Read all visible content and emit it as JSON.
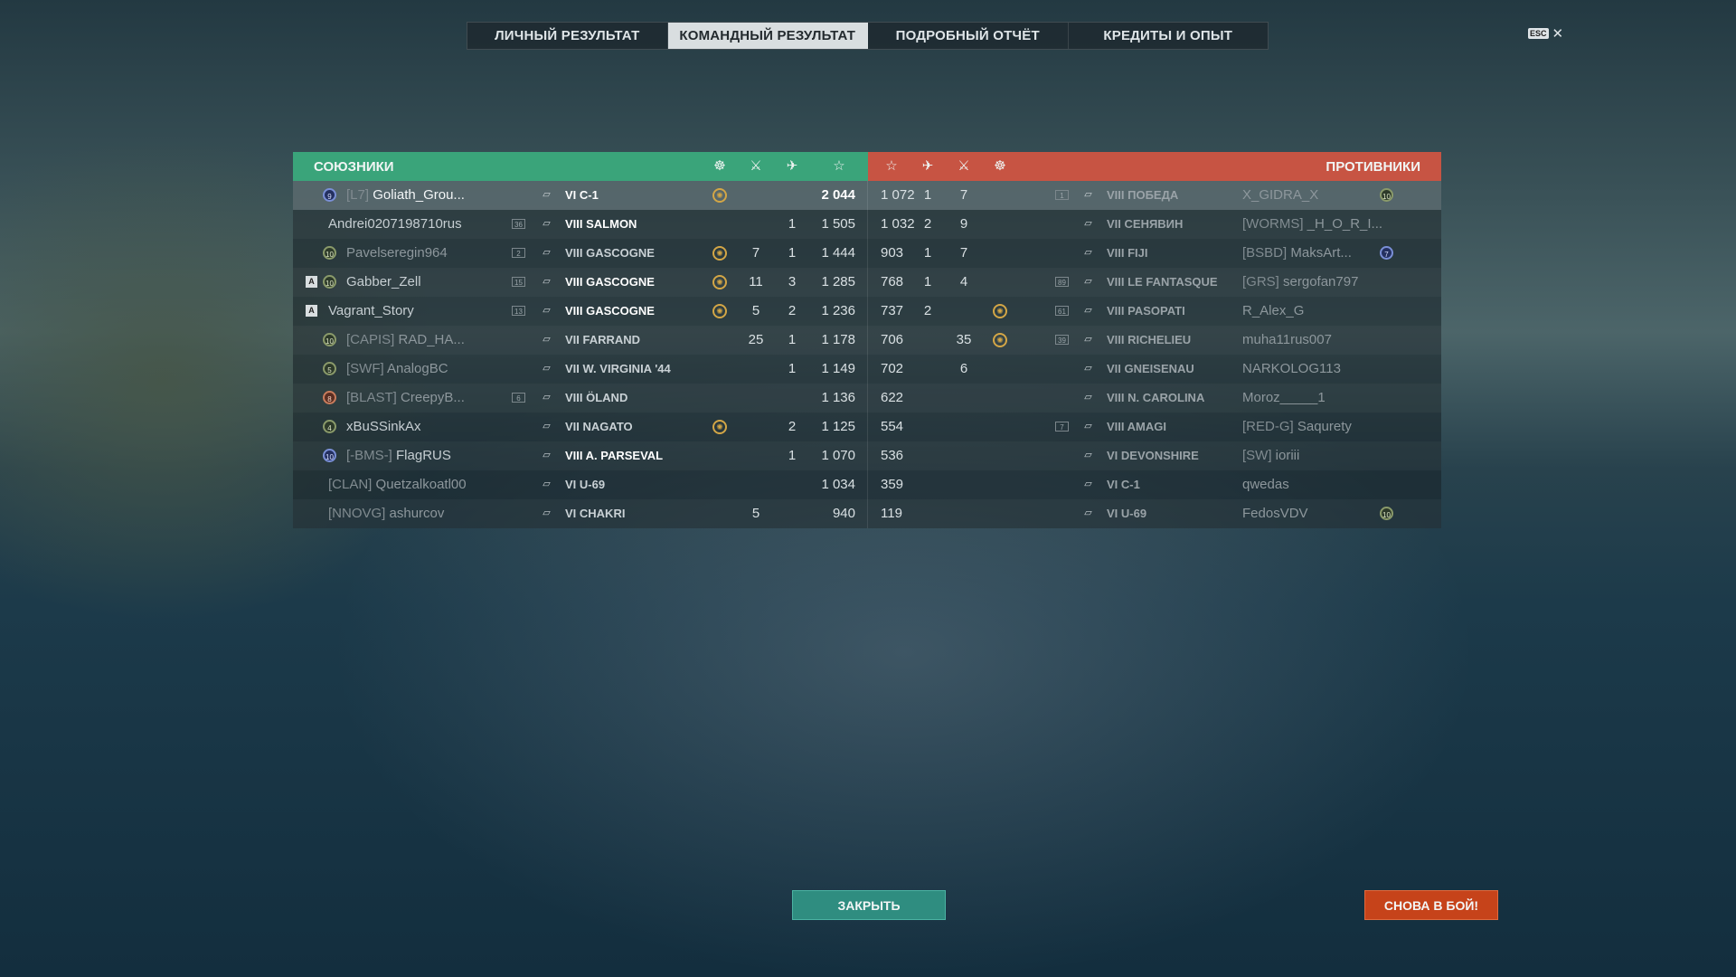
{
  "tabs": [
    {
      "label": "ЛИЧНЫЙ РЕЗУЛЬТАТ",
      "active": false
    },
    {
      "label": "КОМАНДНЫЙ РЕЗУЛЬТАТ",
      "active": true
    },
    {
      "label": "ПОДРОБНЫЙ ОТЧЁТ",
      "active": false
    },
    {
      "label": "КРЕДИТЫ И ОПЫТ",
      "active": false
    }
  ],
  "esc": {
    "key": "ESC",
    "close": "✕"
  },
  "allies": {
    "title": "СОЮЗНИКИ",
    "rows": [
      {
        "badge": "9",
        "clan": "[L7]",
        "name": "Goliath_Grou...",
        "ship": "VI C-1",
        "medal": true,
        "kills": "",
        "planes": "",
        "xp": "2 044",
        "highlight": true
      },
      {
        "badge": "",
        "clan": "",
        "name": "Andrei0207198710rus",
        "lvl": "36",
        "ship": "VIII SALMON",
        "medal": false,
        "kills": "",
        "planes": "1",
        "xp": "1 505"
      },
      {
        "badge": "10",
        "clan": "",
        "name": "Pavelseregin964",
        "lvl": "2",
        "ship": "VIII GASCOGNE",
        "medal": true,
        "kills": "7",
        "planes": "1",
        "xp": "1 444"
      },
      {
        "nickmark": "A",
        "badge": "10",
        "clan": "",
        "name": "Gabber_Zell",
        "lvl": "15",
        "ship": "VIII GASCOGNE",
        "medal": true,
        "kills": "11",
        "planes": "3",
        "xp": "1 285"
      },
      {
        "nickmark": "A",
        "badge": "",
        "clan": "",
        "name": "Vagrant_Story",
        "lvl": "13",
        "ship": "VIII GASCOGNE",
        "medal": true,
        "kills": "5",
        "planes": "2",
        "xp": "1 236"
      },
      {
        "badge": "10",
        "clan": "[CAPIS]",
        "name": "RAD_HA...",
        "ship": "VII FARRAND",
        "medal": false,
        "kills": "25",
        "planes": "1",
        "xp": "1 178"
      },
      {
        "badge": "5",
        "clan": "[SWF]",
        "name": "AnalogBC",
        "ship": "VII W. VIRGINIA '44",
        "medal": false,
        "kills": "",
        "planes": "1",
        "xp": "1 149"
      },
      {
        "badge": "8",
        "clan": "[BLAST]",
        "name": "CreepyB...",
        "lvl": "6",
        "ship": "VIII ÖLAND",
        "medal": false,
        "kills": "",
        "planes": "",
        "xp": "1 136"
      },
      {
        "badge": "4",
        "clan": "",
        "name": "xBuSSinkAx",
        "ship": "VII NAGATO",
        "medal": true,
        "kills": "",
        "planes": "2",
        "xp": "1 125"
      },
      {
        "badge": "10",
        "clan": "[-BMS-]",
        "name": "FlagRUS",
        "ship": "VIII A. PARSEVAL",
        "medal": false,
        "kills": "",
        "planes": "1",
        "xp": "1 070"
      },
      {
        "badge": "",
        "clan": "[CLAN]",
        "name": "Quetzalkoatl00",
        "ship": "VI U-69",
        "medal": false,
        "kills": "",
        "planes": "",
        "xp": "1 034"
      },
      {
        "badge": "",
        "clan": "[NNOVG]",
        "name": "ashurcov",
        "ship": "VI CHAKRI",
        "medal": false,
        "kills": "5",
        "planes": "",
        "xp": "940"
      }
    ]
  },
  "enemies": {
    "title": "ПРОТИВНИКИ",
    "rows": [
      {
        "xp": "1 072",
        "planes": "1",
        "kills": "7",
        "medal": false,
        "lvl": "1",
        "ship": "VIII ПОБЕДА",
        "clan": "",
        "name": "X_GIDRA_X",
        "badge": "10"
      },
      {
        "xp": "1 032",
        "planes": "2",
        "kills": "9",
        "medal": false,
        "lvl": "",
        "ship": "VII СЕНЯВИН",
        "clan": "[WORMS]",
        "name": "_H_O_R_I...",
        "badge": ""
      },
      {
        "xp": "903",
        "planes": "1",
        "kills": "7",
        "medal": false,
        "lvl": "",
        "ship": "VIII FIJI",
        "clan": "[BSBD]",
        "name": "MaksArt...",
        "badge": "7"
      },
      {
        "xp": "768",
        "planes": "1",
        "kills": "4",
        "medal": false,
        "lvl": "89",
        "ship": "VIII LE FANTASQUE",
        "clan": "[GRS]",
        "name": "sergofan797",
        "badge": ""
      },
      {
        "xp": "737",
        "planes": "2",
        "kills": "",
        "medal": true,
        "lvl": "61",
        "ship": "VIII PASOPATI",
        "clan": "",
        "name": "R_Alex_G",
        "badge": ""
      },
      {
        "xp": "706",
        "planes": "",
        "kills": "35",
        "medal": true,
        "lvl": "39",
        "ship": "VIII RICHELIEU",
        "clan": "",
        "name": "muha11rus007",
        "badge": ""
      },
      {
        "xp": "702",
        "planes": "",
        "kills": "6",
        "medal": false,
        "lvl": "",
        "ship": "VII GNEISENAU",
        "clan": "",
        "name": "NARKOLOG113",
        "badge": ""
      },
      {
        "xp": "622",
        "planes": "",
        "kills": "",
        "medal": false,
        "lvl": "",
        "ship": "VIII N. CAROLINA",
        "clan": "",
        "name": "Moroz_____1",
        "badge": ""
      },
      {
        "xp": "554",
        "planes": "",
        "kills": "",
        "medal": false,
        "lvl": "7",
        "ship": "VIII AMAGI",
        "clan": "[RED-G]",
        "name": "Saqurety",
        "badge": ""
      },
      {
        "xp": "536",
        "planes": "",
        "kills": "",
        "medal": false,
        "lvl": "",
        "ship": "VI DEVONSHIRE",
        "clan": "[SW]",
        "name": "ioriii",
        "badge": ""
      },
      {
        "xp": "359",
        "planes": "",
        "kills": "",
        "medal": false,
        "lvl": "",
        "ship": "VI C-1",
        "clan": "",
        "name": "qwedas",
        "badge": ""
      },
      {
        "xp": "119",
        "planes": "",
        "kills": "",
        "medal": false,
        "lvl": "",
        "ship": "VI U-69",
        "clan": "",
        "name": "FedosVDV",
        "badge": "10"
      }
    ]
  },
  "buttons": {
    "close": "ЗАКРЫТЬ",
    "battle": "СНОВА В БОЙ!"
  },
  "icons": {
    "medal": "laurel-medal-icon",
    "kills": "crossed-swords-icon",
    "planes": "plane-icon",
    "xp": "star-icon"
  }
}
